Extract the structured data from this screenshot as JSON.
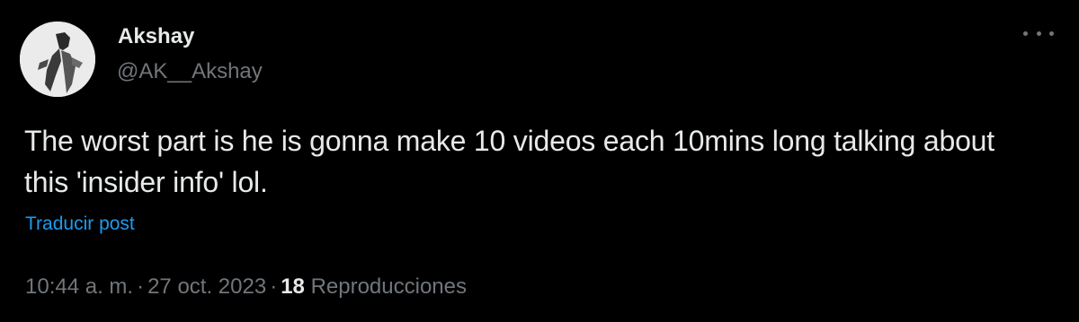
{
  "author": {
    "display_name": "Akshay",
    "handle": "@AK__Akshay"
  },
  "tweet": {
    "text": "The worst part is he is gonna make 10 videos each 10mins long talking about this 'insider info' lol.",
    "translate_label": "Traducir post",
    "time": "10:44 a. m.",
    "separator": "·",
    "date": "27 oct. 2023",
    "views_count": "18",
    "views_label": "Reproducciones"
  },
  "icons": {
    "more": "more-horizontal-icon"
  },
  "colors": {
    "background": "#000000",
    "text_primary": "#e7e9ea",
    "text_secondary": "#71767b",
    "accent": "#1d9bf0"
  }
}
